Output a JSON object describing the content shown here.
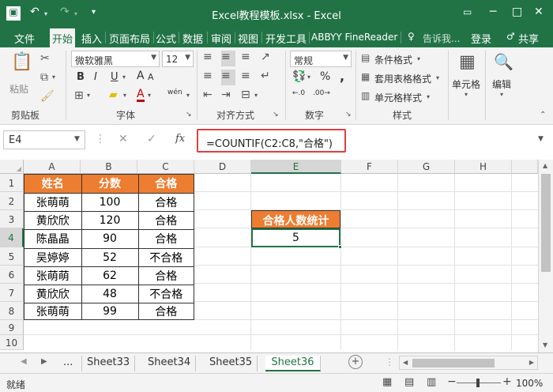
{
  "titlebar": {
    "title": "Excel教程模板.xlsx - Excel",
    "undo_icon": "↶",
    "redo_icon": "↷",
    "minimize_icon": "─",
    "maximize_icon": "□",
    "close_icon": "✕"
  },
  "tabs": [
    "文件",
    "开始",
    "插入",
    "页面布局",
    "公式",
    "数据",
    "审阅",
    "视图",
    "开发工具",
    "ABBYY FineReader"
  ],
  "tell_me": "告诉我...",
  "login": "登录",
  "share": "共享",
  "ribbon": {
    "paste": "粘贴",
    "clipboard": "剪贴板",
    "font_name": "微软雅黑",
    "font_size": "12",
    "font": "字体",
    "bold": "B",
    "italic": "I",
    "underline": "U",
    "grow_font": "A",
    "shrink_font": "A",
    "wen": "wén",
    "alignment": "对齐方式",
    "number_format": "常规",
    "percent": "%",
    "comma": ",",
    "number": "数字",
    "cond_format": "条件格式",
    "table_format": "套用表格格式",
    "cell_style": "单元格样式",
    "styles": "样式",
    "cells": "单元格",
    "edit": "编辑"
  },
  "formula_bar": {
    "name_box": "E4",
    "cancel": "✕",
    "enter": "✓",
    "fx": "fx",
    "formula": "=COUNTIF(C2:C8,\"合格\")"
  },
  "columns": [
    "A",
    "B",
    "C",
    "D",
    "E",
    "F",
    "G",
    "H"
  ],
  "rows": [
    "1",
    "2",
    "3",
    "4",
    "5",
    "6",
    "7",
    "8",
    "9",
    "10"
  ],
  "table": {
    "headers": [
      "姓名",
      "分数",
      "合格"
    ],
    "rows": [
      [
        "张萌萌",
        "100",
        "合格"
      ],
      [
        "黄欣欣",
        "120",
        "合格"
      ],
      [
        "陈晶晶",
        "90",
        "合格"
      ],
      [
        "吴婷婷",
        "52",
        "不合格"
      ],
      [
        "张萌萌",
        "62",
        "合格"
      ],
      [
        "黄欣欣",
        "48",
        "不合格"
      ],
      [
        "张萌萌",
        "99",
        "合格"
      ]
    ]
  },
  "summary": {
    "label": "合格人数统计",
    "value": "5"
  },
  "sheets": [
    "...",
    "Sheet33",
    "Sheet34",
    "Sheet35",
    "Sheet36"
  ],
  "active_sheet": "Sheet36",
  "status": {
    "ready": "就绪",
    "zoom": "100%",
    "zoom_minus": "−",
    "zoom_plus": "+"
  },
  "colors": {
    "excel_green": "#217346",
    "header_orange": "#ed7d31",
    "highlight_red": "#e04040"
  }
}
